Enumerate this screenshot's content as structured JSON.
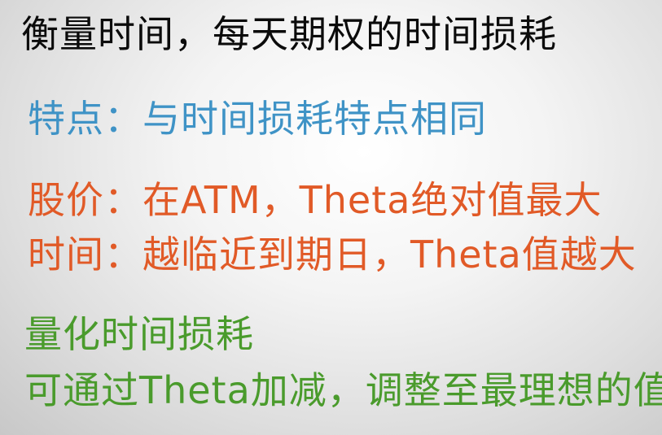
{
  "slide": {
    "title": "衡量时间，每天期权的时间损耗",
    "feature": "特点：与时间损耗特点相同",
    "stock_price": "股价：在ATM，Theta绝对值最大",
    "time": "时间：越临近到期日，Theta值越大",
    "quantify_heading": "量化时间损耗",
    "quantify_detail": "可通过Theta加减，调整至最理想的值"
  },
  "colors": {
    "title": "#0b0b0b",
    "feature": "#3f93c6",
    "stock_price": "#e15a27",
    "time": "#e15a27",
    "quantify": "#4a9b2c"
  }
}
